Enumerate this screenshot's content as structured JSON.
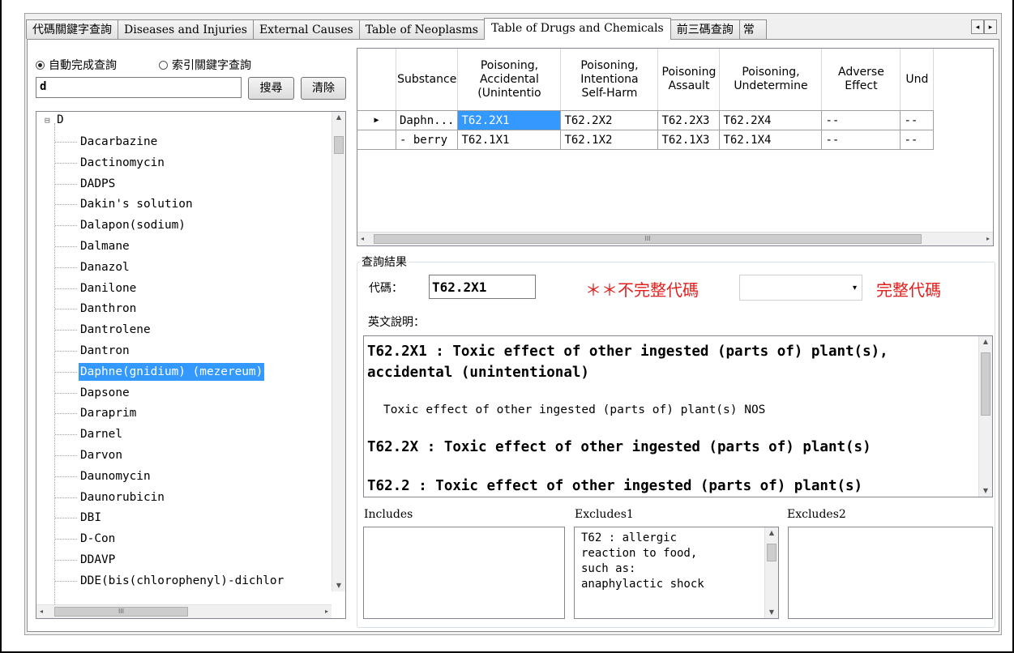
{
  "tabs": [
    "代碼關鍵字查詢",
    "Diseases and Injuries",
    "External Causes",
    "Table of Neoplasms",
    "Table of Drugs and Chemicals",
    "前三碼查詢",
    "常"
  ],
  "active_tab": "Table of Drugs and Chemicals",
  "tab_scroll": {
    "left": "◂",
    "right": "▸"
  },
  "search": {
    "radio_autocomplete": "自動完成查詢",
    "radio_index": "索引關鍵字查詢",
    "selected_mode": "自動完成查詢",
    "query": "d",
    "search_button": "搜尋",
    "clear_button": "清除"
  },
  "tree": {
    "root": "D",
    "expander": "⊟",
    "items": [
      "Dacarbazine",
      "Dactinomycin",
      "DADPS",
      "Dakin's solution",
      "Dalapon(sodium)",
      "Dalmane",
      "Danazol",
      "Danilone",
      "Danthron",
      "Dantrolene",
      "Dantron",
      "Daphne(gnidium) (mezereum)",
      "Dapsone",
      "Daraprim",
      "Darnel",
      "Darvon",
      "Daunomycin",
      "Daunorubicin",
      "DBI",
      "D-Con",
      "DDAVP",
      "DDE(bis(chlorophenyl)-dichlor"
    ],
    "selected": "Daphne(gnidium) (mezereum)",
    "scroll_arrows": {
      "up": "▲",
      "down": "▼",
      "left": "◂",
      "right": "▸"
    },
    "hscroll_thumb": "III"
  },
  "grid": {
    "columns": [
      "Substance",
      "Poisoning,\nAccidental\n(Unintentio",
      "Poisoning,\nIntentiona\nSelf-Harm",
      "Poisoning\nAssault",
      "Poisoning,\nUndetermine",
      "Adverse\nEffect",
      "Und"
    ],
    "rows": [
      {
        "indicator": "▶",
        "cells": [
          "Daphn...",
          "T62.2X1",
          "T62.2X2",
          "T62.2X3",
          "T62.2X4",
          "--",
          "--"
        ]
      },
      {
        "indicator": "",
        "cells": [
          "- berry",
          "T62.1X1",
          "T62.1X2",
          "T62.1X3",
          "T62.1X4",
          "--",
          "--"
        ]
      }
    ],
    "selected_cell": "T62.2X1",
    "hscroll_thumb": "III"
  },
  "result": {
    "group_title": "查詢結果",
    "code_label": "代碼：",
    "code_value": "T62.2X1",
    "incomplete_warning": "＊＊不完整代碼",
    "combo_value": "",
    "combo_arrow": "▾",
    "complete_label": "完整代碼",
    "english_label": "英文說明：",
    "desc_line1": "T62.2X1 : Toxic effect of other ingested (parts of) plant(s),",
    "desc_line2": "accidental (unintentional)",
    "desc_note": "Toxic effect of other ingested (parts of) plant(s) NOS",
    "desc_line3": "T62.2X : Toxic effect of other ingested (parts of) plant(s)",
    "desc_line4": "T62.2 : Toxic effect of other ingested (parts of) plant(s)",
    "includes_label": "Includes",
    "includes_text": "",
    "excludes1_label": "Excludes1",
    "excludes1_text": "T62 : allergic\nreaction to food,\nsuch as:\nanaphylactic shock",
    "excludes2_label": "Excludes2",
    "excludes2_text": ""
  }
}
